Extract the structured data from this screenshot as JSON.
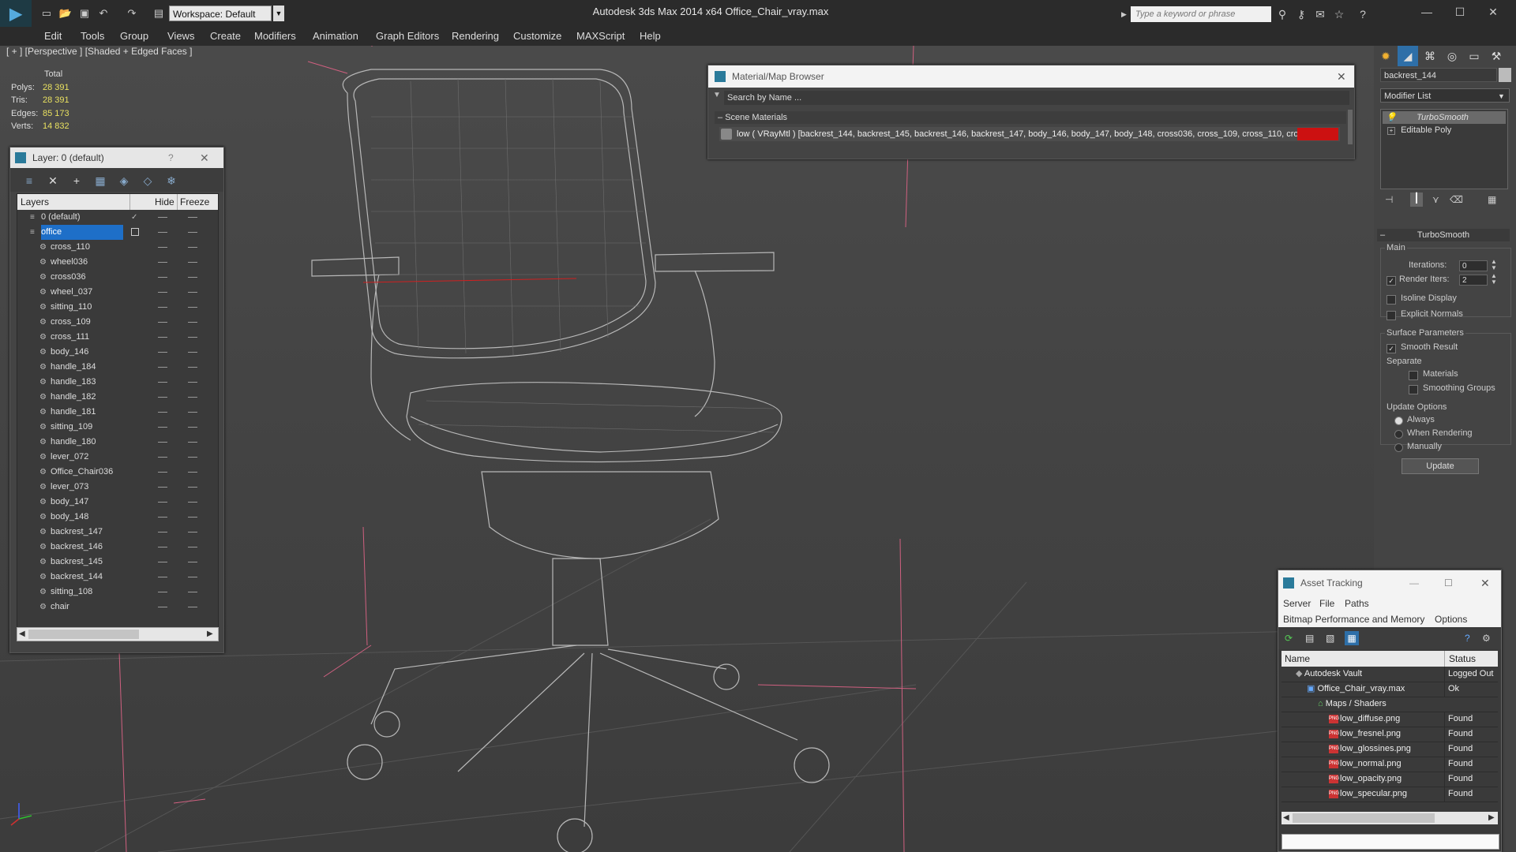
{
  "app": {
    "title": "Autodesk 3ds Max  2014 x64      Office_Chair_vray.max",
    "workspace": "Workspace: Default",
    "search_placeholder": "Type a keyword or phrase"
  },
  "menu": [
    "Edit",
    "Tools",
    "Group",
    "Views",
    "Create",
    "Modifiers",
    "Animation",
    "Graph Editors",
    "Rendering",
    "Customize",
    "MAXScript",
    "Help"
  ],
  "viewport": {
    "label": "[ + ] [Perspective ] [Shaded + Edged Faces ]",
    "stats": {
      "header": "Total",
      "rows": [
        {
          "k": "Polys:",
          "v": "28 391"
        },
        {
          "k": "Tris:",
          "v": "28 391"
        },
        {
          "k": "Edges:",
          "v": "85 173"
        },
        {
          "k": "Verts:",
          "v": "14 832"
        }
      ]
    }
  },
  "layer_panel": {
    "title": "Layer: 0 (default)",
    "help": "?",
    "col_layers": "Layers",
    "col_hide": "Hide",
    "col_freeze": "Freeze",
    "rows": [
      "0 (default)",
      "office",
      "cross_110",
      "wheel036",
      "cross036",
      "wheel_037",
      "sitting_110",
      "cross_109",
      "cross_111",
      "body_146",
      "handle_184",
      "handle_183",
      "handle_182",
      "handle_181",
      "sitting_109",
      "handle_180",
      "lever_072",
      "Office_Chair036",
      "lever_073",
      "body_147",
      "body_148",
      "backrest_147",
      "backrest_146",
      "backrest_145",
      "backrest_144",
      "sitting_108",
      "chair"
    ]
  },
  "material_browser": {
    "title": "Material/Map Browser",
    "search": "Search by Name ...",
    "section": "Scene Materials",
    "item": "low  ( VRayMtl ) [backrest_144, backrest_145, backrest_146, backrest_147, body_146, body_147, body_148, cross036, cross_109, cross_110, cross_..."
  },
  "command_panel": {
    "object_name": "backrest_144",
    "modifier_list": "Modifier List",
    "stack": [
      "TurboSmooth",
      "Editable Poly"
    ],
    "rollout": "TurboSmooth",
    "main": "Main",
    "iterations_label": "Iterations:",
    "iterations": "0",
    "render_iters_label": "Render Iters:",
    "render_iters": "2",
    "isoline": "Isoline Display",
    "explicit_normals": "Explicit Normals",
    "surface_params": "Surface Parameters",
    "smooth_result": "Smooth Result",
    "separate": "Separate",
    "materials": "Materials",
    "smoothing_groups": "Smoothing Groups",
    "update_options": "Update Options",
    "always": "Always",
    "when_rendering": "When Rendering",
    "manually": "Manually",
    "update_btn": "Update"
  },
  "asset_tracking": {
    "title": "Asset Tracking",
    "menu1": [
      "Server",
      "File",
      "Paths"
    ],
    "menu2": [
      "Bitmap Performance and Memory",
      "Options"
    ],
    "col_name": "Name",
    "col_status": "Status",
    "rows": [
      {
        "name": "Autodesk Vault",
        "status": "Logged Out",
        "indent": 1
      },
      {
        "name": "Office_Chair_vray.max",
        "status": "Ok",
        "indent": 2
      },
      {
        "name": "Maps / Shaders",
        "status": "",
        "indent": 3
      },
      {
        "name": "low_diffuse.png",
        "status": "Found",
        "indent": 4
      },
      {
        "name": "low_fresnel.png",
        "status": "Found",
        "indent": 4
      },
      {
        "name": "low_glossines.png",
        "status": "Found",
        "indent": 4
      },
      {
        "name": "low_normal.png",
        "status": "Found",
        "indent": 4
      },
      {
        "name": "low_opacity.png",
        "status": "Found",
        "indent": 4
      },
      {
        "name": "low_specular.png",
        "status": "Found",
        "indent": 4
      }
    ]
  },
  "colors": {
    "accent": "#1e6fc8",
    "stat_value": "#e8e060",
    "material_swatch": "#cc1111"
  }
}
